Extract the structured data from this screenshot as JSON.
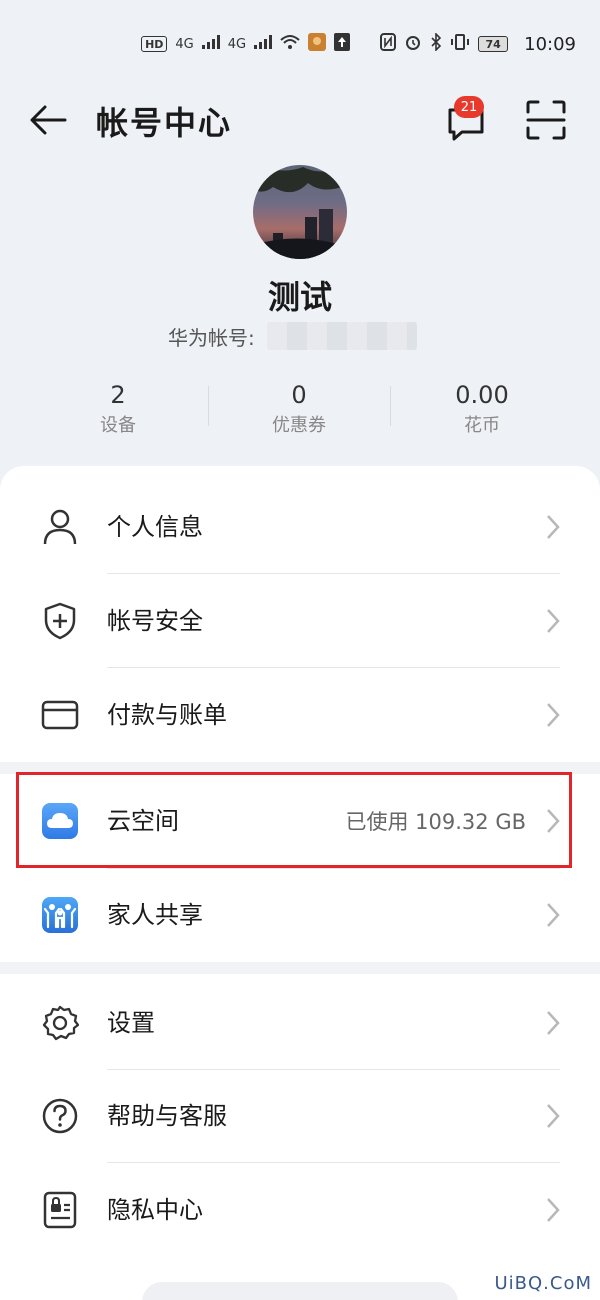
{
  "status_bar": {
    "time": "10:09",
    "battery": "74",
    "network_1": "4G",
    "network_2": "4G",
    "sim_1": "HD",
    "sim_2": "HD"
  },
  "header": {
    "title": "帐号中心",
    "message_badge": "21"
  },
  "profile": {
    "username": "测试",
    "account_label": "华为帐号:"
  },
  "stats": [
    {
      "value": "2",
      "label": "设备"
    },
    {
      "value": "0",
      "label": "优惠券"
    },
    {
      "value": "0.00",
      "label": "花币"
    }
  ],
  "menu": {
    "personal_info": "个人信息",
    "account_security": "帐号安全",
    "payment_billing": "付款与账单",
    "cloud_space": "云空间",
    "cloud_space_value": "已使用 109.32 GB",
    "family_sharing": "家人共享",
    "settings": "设置",
    "help_service": "帮助与客服",
    "privacy_center": "隐私中心"
  },
  "colors": {
    "accent_red": "#e8392d",
    "highlight_red": "#e0252b",
    "cloud_blue": "#3d8ff0"
  },
  "watermark": "UiBQ.CoM"
}
